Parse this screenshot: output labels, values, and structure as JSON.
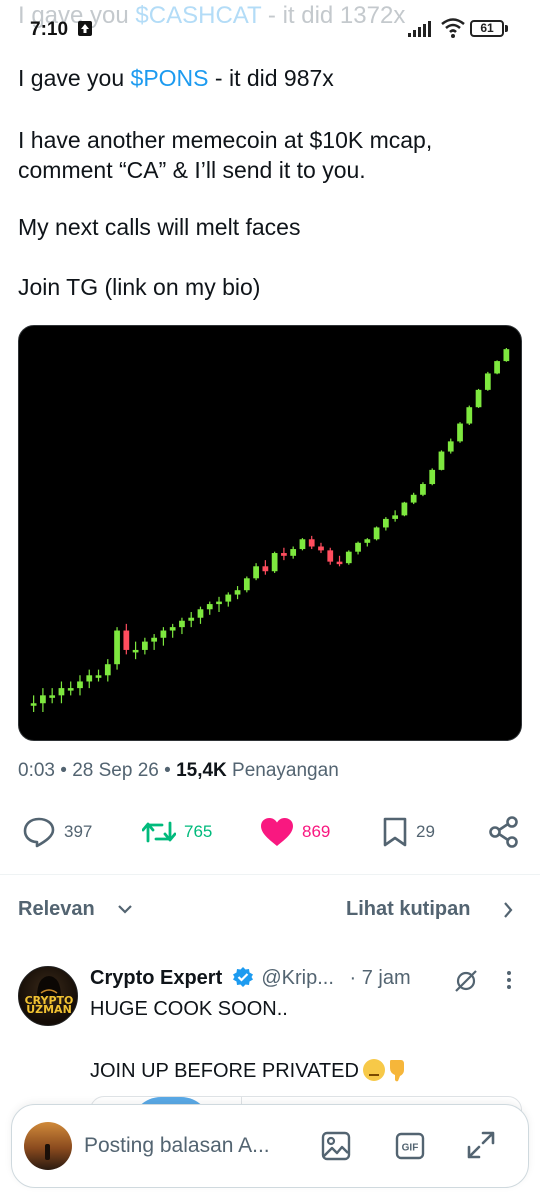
{
  "status_bar": {
    "ghost_prefix": "I gave you ",
    "ghost_ticker": "$CASHCAT",
    "ghost_suffix": " - it did 1372x",
    "time": "7:10",
    "battery": "61"
  },
  "tweet": {
    "line1_prefix": "I gave you ",
    "line1_ticker": "$PONS",
    "line1_suffix": " - it did 987x",
    "paragraph2": "I have another memecoin at $10K mcap, comment “CA” & I’ll send it to you.",
    "paragraph3": "My next calls will melt faces",
    "paragraph4": "Join TG (link on my bio)"
  },
  "chart_data": {
    "type": "candlestick",
    "title": "",
    "xlabel": "",
    "ylabel": "",
    "grid": false,
    "colors": {
      "up": "#7ee83f",
      "down": "#ff4d5e",
      "background": "#000000"
    },
    "candles": [
      [
        1.0,
        1.1,
        0.9,
        1.0
      ],
      [
        1.0,
        1.2,
        0.9,
        1.1
      ],
      [
        1.1,
        1.2,
        1.0,
        1.1
      ],
      [
        1.1,
        1.3,
        1.0,
        1.2
      ],
      [
        1.2,
        1.3,
        1.1,
        1.2
      ],
      [
        1.2,
        1.4,
        1.1,
        1.3
      ],
      [
        1.3,
        1.5,
        1.2,
        1.4
      ],
      [
        1.4,
        1.5,
        1.3,
        1.4
      ],
      [
        1.4,
        1.7,
        1.3,
        1.6
      ],
      [
        1.6,
        2.5,
        1.5,
        2.4
      ],
      [
        2.4,
        2.6,
        1.8,
        1.9
      ],
      [
        1.9,
        2.1,
        1.7,
        1.9
      ],
      [
        1.9,
        2.2,
        1.8,
        2.1
      ],
      [
        2.1,
        2.3,
        1.9,
        2.2
      ],
      [
        2.2,
        2.5,
        2.0,
        2.4
      ],
      [
        2.4,
        2.6,
        2.2,
        2.5
      ],
      [
        2.5,
        2.8,
        2.3,
        2.7
      ],
      [
        2.7,
        3.0,
        2.5,
        2.8
      ],
      [
        2.8,
        3.2,
        2.6,
        3.1
      ],
      [
        3.1,
        3.4,
        2.9,
        3.3
      ],
      [
        3.3,
        3.6,
        3.0,
        3.4
      ],
      [
        3.4,
        3.8,
        3.2,
        3.7
      ],
      [
        3.7,
        4.1,
        3.5,
        3.9
      ],
      [
        3.9,
        4.6,
        3.8,
        4.5
      ],
      [
        4.5,
        5.4,
        4.4,
        5.2
      ],
      [
        5.2,
        5.6,
        4.7,
        4.9
      ],
      [
        4.9,
        6.2,
        4.8,
        6.1
      ],
      [
        6.1,
        6.5,
        5.6,
        5.9
      ],
      [
        5.9,
        6.6,
        5.7,
        6.4
      ],
      [
        6.4,
        7.3,
        6.3,
        7.2
      ],
      [
        7.2,
        7.5,
        6.4,
        6.6
      ],
      [
        6.6,
        6.9,
        6.1,
        6.3
      ],
      [
        6.3,
        6.5,
        5.3,
        5.5
      ],
      [
        5.5,
        5.9,
        5.2,
        5.4
      ],
      [
        5.4,
        6.3,
        5.3,
        6.2
      ],
      [
        6.2,
        7.0,
        6.0,
        6.9
      ],
      [
        6.9,
        7.3,
        6.6,
        7.2
      ],
      [
        7.2,
        8.4,
        7.1,
        8.3
      ],
      [
        8.3,
        9.4,
        8.0,
        9.2
      ],
      [
        9.2,
        10.2,
        8.9,
        9.6
      ],
      [
        9.6,
        11.3,
        9.5,
        11.2
      ],
      [
        11.2,
        12.6,
        11.0,
        12.3
      ],
      [
        12.3,
        14.3,
        12.1,
        14.0
      ],
      [
        14.0,
        16.9,
        13.8,
        16.6
      ],
      [
        16.6,
        21.0,
        16.5,
        20.7
      ],
      [
        20.7,
        24.2,
        20.2,
        23.4
      ],
      [
        23.4,
        29.5,
        23.0,
        29.0
      ],
      [
        29.0,
        36.0,
        28.5,
        35.3
      ],
      [
        35.3,
        44.0,
        35.0,
        43.5
      ],
      [
        43.5,
        54.0,
        43.0,
        53.0
      ],
      [
        53.0,
        62.0,
        52.5,
        61.5
      ],
      [
        61.5,
        72.0,
        61.0,
        71.0
      ]
    ]
  },
  "meta": {
    "time": "0:03",
    "date": "28 Sep 26",
    "views_count": "15,4K",
    "views_label": "Penayangan"
  },
  "actions": {
    "replies": "397",
    "reposts": "765",
    "likes": "869",
    "bookmarks": "29"
  },
  "filter": {
    "sort_label": "Relevan",
    "quotes_label": "Lihat kutipan"
  },
  "reply": {
    "avatar_text": "CRYPTO UZMAN",
    "name": "Crypto Expert",
    "handle": "@Krip...",
    "time": "· 7 jam",
    "line1": "HUGE COOK SOON..",
    "line2": "JOIN UP BEFORE PRIVATED"
  },
  "compose": {
    "placeholder": "Posting balasan A..."
  }
}
